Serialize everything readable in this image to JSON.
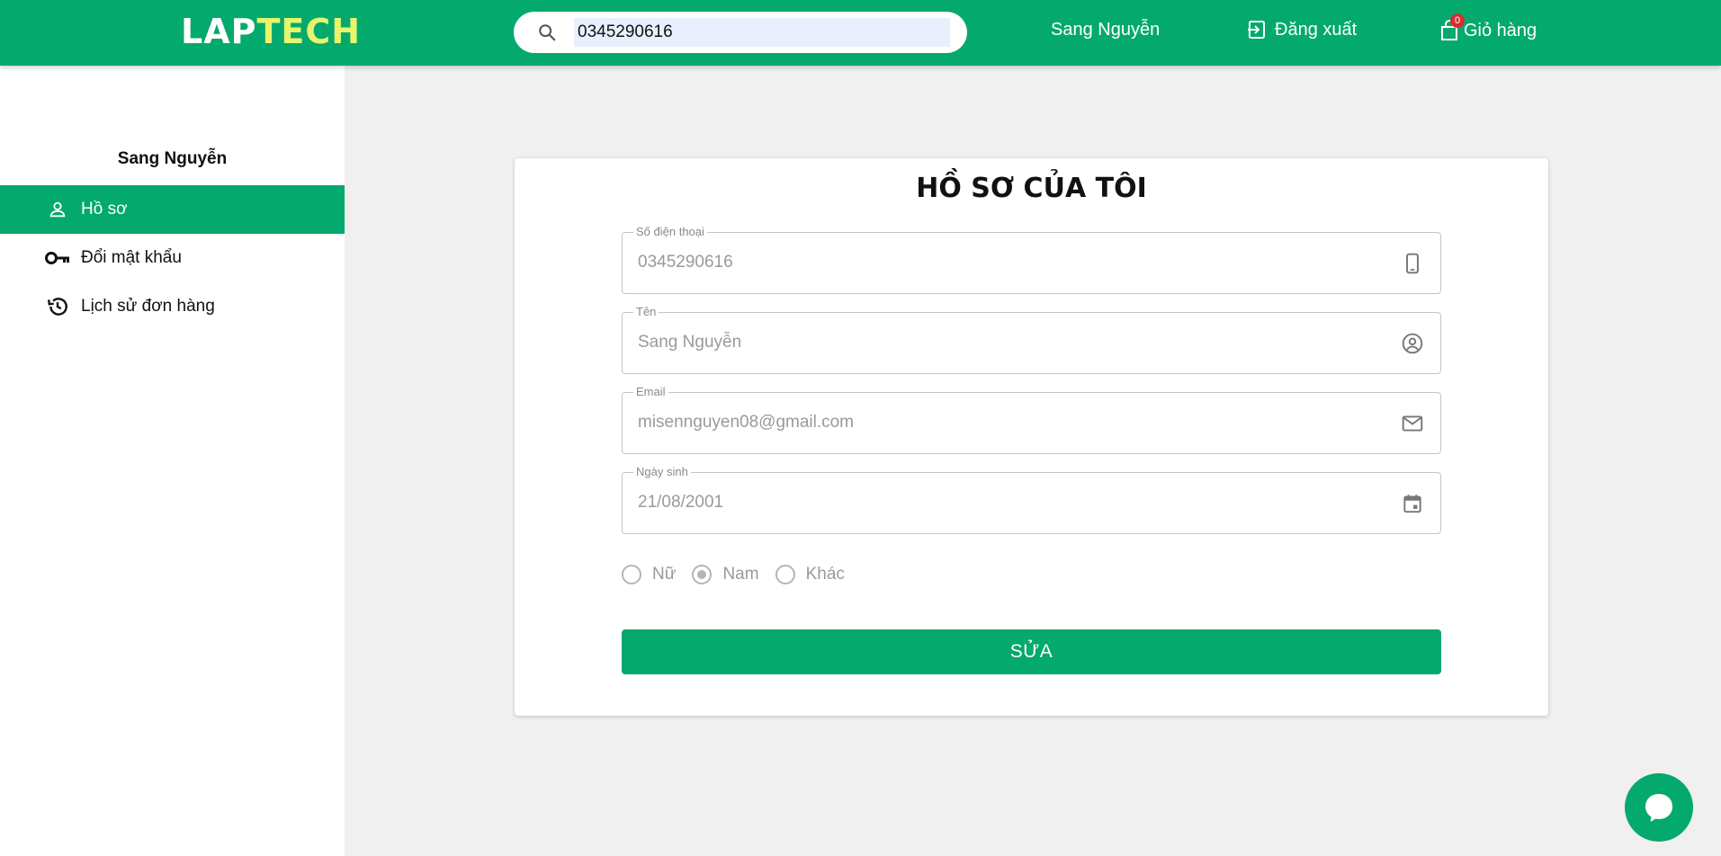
{
  "header": {
    "logo_part1": "LAP",
    "logo_part2": "TECH",
    "search_value": "0345290616",
    "user_name": "Sang Nguyễn",
    "logout_label": "Đăng xuất",
    "cart_label": "Giỏ hàng",
    "cart_count": "0"
  },
  "sidebar": {
    "user_name": "Sang Nguyễn",
    "items": [
      {
        "label": "Hồ sơ",
        "icon": "person-icon",
        "active": true
      },
      {
        "label": "Đổi mật khẩu",
        "icon": "key-icon",
        "active": false
      },
      {
        "label": "Lịch sử đơn hàng",
        "icon": "history-icon",
        "active": false
      }
    ]
  },
  "profile": {
    "title": "HỒ SƠ CỦA TÔI",
    "fields": [
      {
        "label": "Số điện thoại",
        "value": "0345290616",
        "icon": "phone-icon"
      },
      {
        "label": "Tên",
        "value": "Sang Nguyễn",
        "icon": "account-circle-icon"
      },
      {
        "label": "Email",
        "value": "misennguyen08@gmail.com",
        "icon": "mail-icon"
      },
      {
        "label": "Ngày sinh",
        "value": "21/08/2001",
        "icon": "calendar-icon"
      }
    ],
    "gender_options": [
      "Nữ",
      "Nam",
      "Khác"
    ],
    "gender_selected": "Nam",
    "edit_button": "SỬA"
  },
  "colors": {
    "brand": "#04a96d",
    "logo_accent": "#e7f56b"
  }
}
